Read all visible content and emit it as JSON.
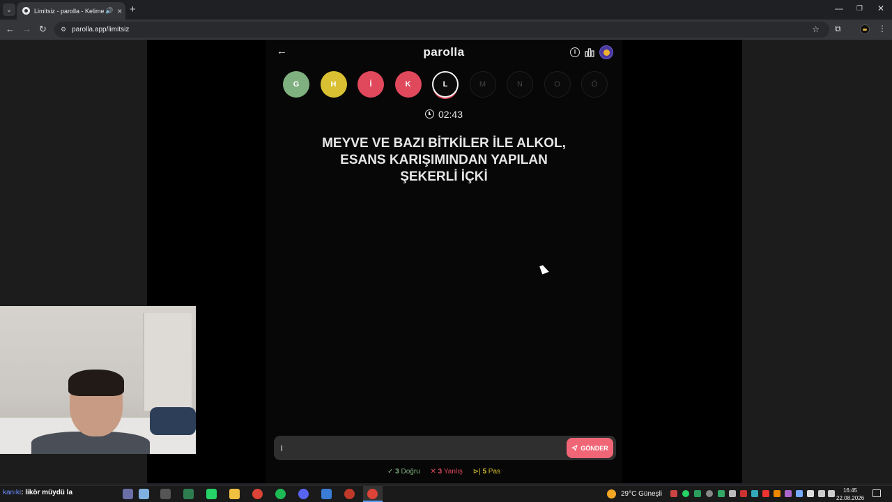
{
  "browser": {
    "tab_title": "Limitsiz - parolla - Kelime o",
    "url": "parolla.app/limitsiz",
    "new_tab_label": "+",
    "minimize_label": "—",
    "restore_label": "❐",
    "close_label": "✕"
  },
  "app": {
    "title": "parolla",
    "letters": [
      {
        "label": "G",
        "state": "correct"
      },
      {
        "label": "H",
        "state": "pass"
      },
      {
        "label": "İ",
        "state": "wrong"
      },
      {
        "label": "K",
        "state": "wrong"
      },
      {
        "label": "L",
        "state": "current"
      },
      {
        "label": "M",
        "state": "pending"
      },
      {
        "label": "N",
        "state": "pending"
      },
      {
        "label": "O",
        "state": "pending"
      },
      {
        "label": "Ö",
        "state": "pending"
      }
    ],
    "timer": "02:43",
    "question_lines": [
      "MEYVE VE BAZI BİTKİLER İLE ALKOL,",
      "ESANS KARIŞIMINDAN YAPILAN",
      "ŞEKERLİ İÇKİ"
    ],
    "answer_value": "l",
    "send_label": "GÖNDER",
    "stats": {
      "correct_count": "3",
      "correct_label": "Doğru",
      "wrong_count": "3",
      "wrong_label": "Yanlış",
      "pass_count": "5",
      "pass_label": "Pas"
    },
    "colors": {
      "correct": "#7fb07f",
      "pass": "#d9c032",
      "wrong": "#e0485c",
      "send": "#f06676"
    }
  },
  "taskbar": {
    "search_prefix": "kanıki",
    "search_text": ": likör müydü la",
    "weather": "29°C  Güneşli",
    "time": "16:45",
    "date": "22.08.2026"
  }
}
